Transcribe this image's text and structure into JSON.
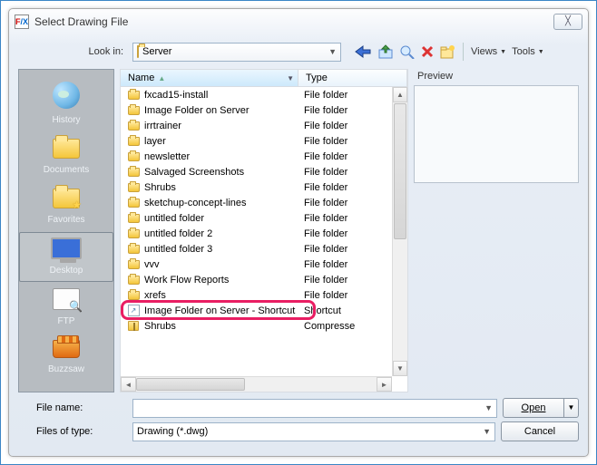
{
  "window": {
    "title": "Select Drawing File"
  },
  "lookIn": {
    "label": "Look in:",
    "value": "Server"
  },
  "toolbar": {
    "views": "Views",
    "tools": "Tools"
  },
  "sidebar": {
    "items": [
      {
        "label": "History"
      },
      {
        "label": "Documents"
      },
      {
        "label": "Favorites"
      },
      {
        "label": "Desktop"
      },
      {
        "label": "FTP"
      },
      {
        "label": "Buzzsaw"
      }
    ]
  },
  "columns": {
    "name": "Name",
    "type": "Type"
  },
  "files": [
    {
      "name": "fxcad15-install",
      "type": "File folder",
      "kind": "folder"
    },
    {
      "name": "Image Folder on Server",
      "type": "File folder",
      "kind": "folder"
    },
    {
      "name": "irrtrainer",
      "type": "File folder",
      "kind": "folder"
    },
    {
      "name": "layer",
      "type": "File folder",
      "kind": "folder"
    },
    {
      "name": "newsletter",
      "type": "File folder",
      "kind": "folder"
    },
    {
      "name": "Salvaged Screenshots",
      "type": "File folder",
      "kind": "folder"
    },
    {
      "name": "Shrubs",
      "type": "File folder",
      "kind": "folder"
    },
    {
      "name": "sketchup-concept-lines",
      "type": "File folder",
      "kind": "folder"
    },
    {
      "name": "untitled folder",
      "type": "File folder",
      "kind": "folder"
    },
    {
      "name": "untitled folder 2",
      "type": "File folder",
      "kind": "folder"
    },
    {
      "name": "untitled folder 3",
      "type": "File folder",
      "kind": "folder"
    },
    {
      "name": "vvv",
      "type": "File folder",
      "kind": "folder"
    },
    {
      "name": "Work Flow Reports",
      "type": "File folder",
      "kind": "folder"
    },
    {
      "name": "xrefs",
      "type": "File folder",
      "kind": "folder"
    },
    {
      "name": "Image Folder on Server - Shortcut",
      "type": "Shortcut",
      "kind": "shortcut"
    },
    {
      "name": "Shrubs",
      "type": "Compresse",
      "kind": "compressed"
    }
  ],
  "preview": {
    "label": "Preview"
  },
  "form": {
    "fileNameLabel": "File name:",
    "fileNameValue": "",
    "fileTypeLabel": "Files of type:",
    "fileTypeValue": "Drawing (*.dwg)"
  },
  "buttons": {
    "open": "Open",
    "cancel": "Cancel"
  }
}
